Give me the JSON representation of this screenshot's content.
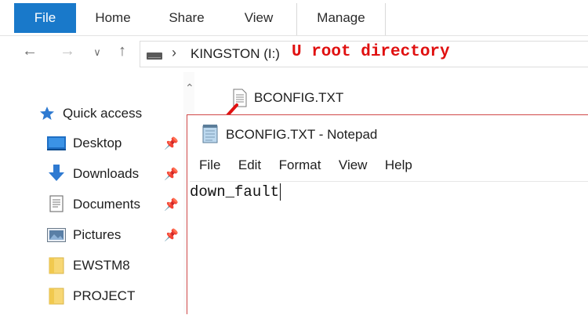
{
  "ribbon": {
    "tabs": [
      "File",
      "Home",
      "Share",
      "View",
      "Manage"
    ]
  },
  "address": {
    "path": "KINGSTON (I:)",
    "annotation": "U root directory"
  },
  "sidebar": {
    "quick_access": "Quick access",
    "items": [
      {
        "label": "Desktop",
        "icon": "desktop-icon",
        "pinned": true
      },
      {
        "label": "Downloads",
        "icon": "download-arrow-icon",
        "pinned": true
      },
      {
        "label": "Documents",
        "icon": "document-icon",
        "pinned": true
      },
      {
        "label": "Pictures",
        "icon": "pictures-icon",
        "pinned": true
      },
      {
        "label": "EWSTM8",
        "icon": "folder-icon",
        "pinned": false
      },
      {
        "label": "PROJECT",
        "icon": "folder-icon",
        "pinned": false
      }
    ]
  },
  "files": [
    {
      "name": "BCONFIG.TXT",
      "icon": "text-file-icon"
    }
  ],
  "notepad": {
    "title": "BCONFIG.TXT - Notepad",
    "menu": [
      "File",
      "Edit",
      "Format",
      "View",
      "Help"
    ],
    "content": "down_fault"
  },
  "colors": {
    "file_tab": "#1979ca",
    "annotation": "#e01010",
    "notepad_border": "#d04848"
  }
}
